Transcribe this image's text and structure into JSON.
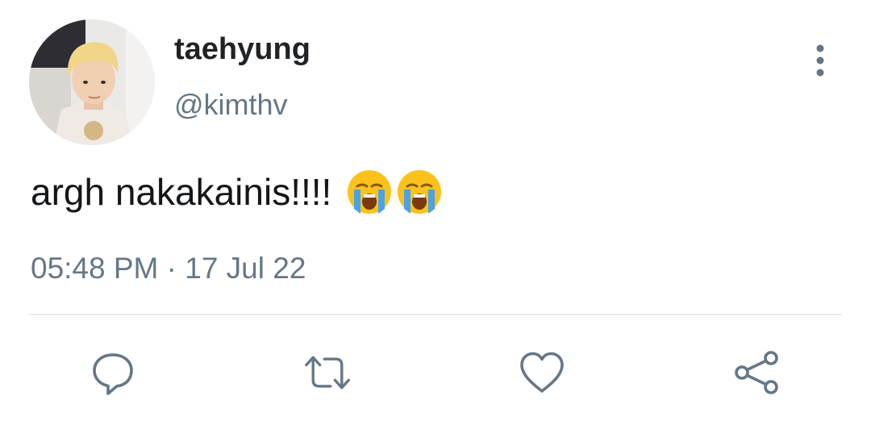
{
  "tweet": {
    "display_name": "taehyung",
    "handle": "@kimthv",
    "text": "argh nakakainis!!!!",
    "emojis": [
      "loudly-crying-face",
      "loudly-crying-face"
    ],
    "timestamp": "05:48 PM · 17 Jul 22"
  },
  "icons": {
    "more": "vertical-dots-icon",
    "reply": "speech-bubble-icon",
    "retweet": "retweet-arrows-icon",
    "like": "heart-icon",
    "share": "share-nodes-icon"
  },
  "colors": {
    "text": "#14171a",
    "secondary": "#657786",
    "divider": "#e6ecf0"
  }
}
